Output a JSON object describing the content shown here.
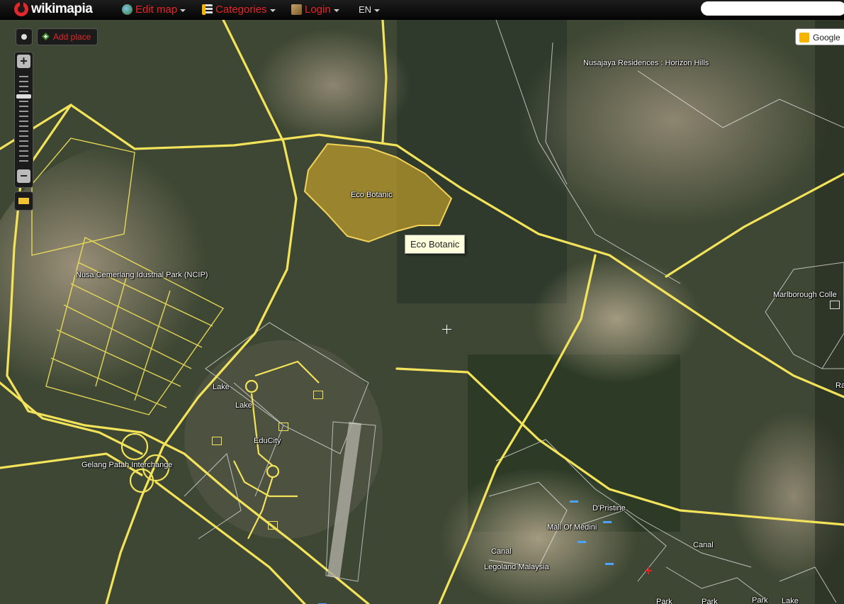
{
  "app": {
    "logo_text": "wikimapia"
  },
  "menu": {
    "edit_map": "Edit map",
    "categories": "Categories",
    "login": "Login",
    "language": "EN"
  },
  "search": {
    "value": "",
    "placeholder": ""
  },
  "controls": {
    "add_place": "Add place",
    "zoom_in": "+",
    "zoom_out": "−",
    "zoom_level_fraction": 0.75,
    "google": "Google"
  },
  "tooltip": {
    "text": "Eco Botanic"
  },
  "map_labels": [
    {
      "id": "nusajaya",
      "text": "Nusajaya Residences : Horizon Hills"
    },
    {
      "id": "eco-botanic",
      "text": "Eco Botanic"
    },
    {
      "id": "ncip",
      "text": "Nusa Cemerlang Idustrial Park (NCIP)"
    },
    {
      "id": "marlborough",
      "text": "Marlborough Colle"
    },
    {
      "id": "ra",
      "text": "Ra"
    },
    {
      "id": "lake-1",
      "text": "Lake"
    },
    {
      "id": "lake-2",
      "text": "Lake"
    },
    {
      "id": "educity",
      "text": "EduCity"
    },
    {
      "id": "gelang-patah",
      "text": "Gelang Patah Interchange"
    },
    {
      "id": "d-pristine",
      "text": "D'Pristine"
    },
    {
      "id": "mall-of-medini",
      "text": "Mall Of Medini"
    },
    {
      "id": "canal-1",
      "text": "Canal"
    },
    {
      "id": "canal-2",
      "text": "Canal"
    },
    {
      "id": "legoland",
      "text": "Legoland Malaysia"
    },
    {
      "id": "park-1",
      "text": "Park"
    },
    {
      "id": "park-2",
      "text": "Park"
    },
    {
      "id": "park-3",
      "text": "Park"
    },
    {
      "id": "lake-3",
      "text": "Lake"
    }
  ],
  "colors": {
    "road": "#f3e35a",
    "highlight": "#e8b829",
    "menu_text": "#e62626"
  }
}
